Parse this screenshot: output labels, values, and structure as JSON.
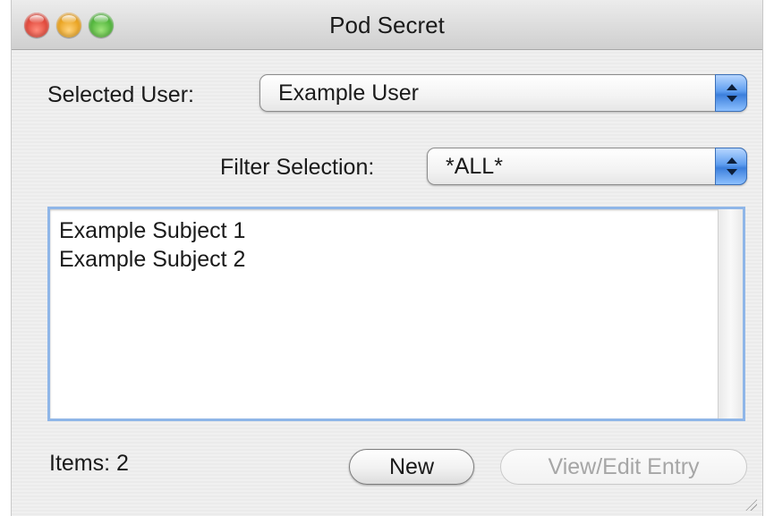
{
  "window": {
    "title": "Pod Secret",
    "controls": [
      "close-icon",
      "minimize-icon",
      "zoom-icon"
    ]
  },
  "selected_user": {
    "label": "Selected User:",
    "value": "Example User"
  },
  "filter": {
    "label": "Filter Selection:",
    "value": "*ALL*"
  },
  "list": {
    "items": [
      "Example Subject 1",
      "Example Subject 2"
    ]
  },
  "footer": {
    "items_count": "Items: 2",
    "new_label": "New",
    "view_edit_label": "View/Edit Entry"
  },
  "colors": {
    "focus_ring": "#8fb6e8",
    "popup_arrow": "#3c7fdc",
    "close": "#e0473a",
    "minimize": "#e9a21e",
    "zoom": "#4fb43a"
  }
}
